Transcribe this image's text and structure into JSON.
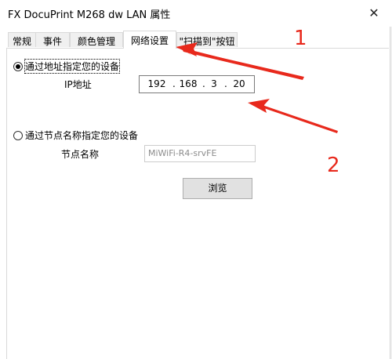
{
  "window": {
    "title": "FX DocuPrint M268 dw LAN 属性",
    "close_glyph": "✕"
  },
  "tabs": [
    {
      "label": "常规",
      "active": false
    },
    {
      "label": "事件",
      "active": false
    },
    {
      "label": "颜色管理",
      "active": false
    },
    {
      "label": "网络设置",
      "active": true
    },
    {
      "label": "\"扫描到\"按钮",
      "active": false
    }
  ],
  "network": {
    "option_ip_label": "通过地址指定您的设备",
    "option_ip_selected": true,
    "ip_label": "IP地址",
    "ip": [
      "192",
      "168",
      "3",
      "20"
    ],
    "ip_dot": ".",
    "option_name_label": "通过节点名称指定您的设备",
    "option_name_selected": false,
    "node_name_label": "节点名称",
    "node_name_value": "MiWiFi-R4-srvFE",
    "browse_label": "浏览"
  },
  "annotations": {
    "color": "#e8291c",
    "numbers": [
      "1",
      "2"
    ]
  }
}
